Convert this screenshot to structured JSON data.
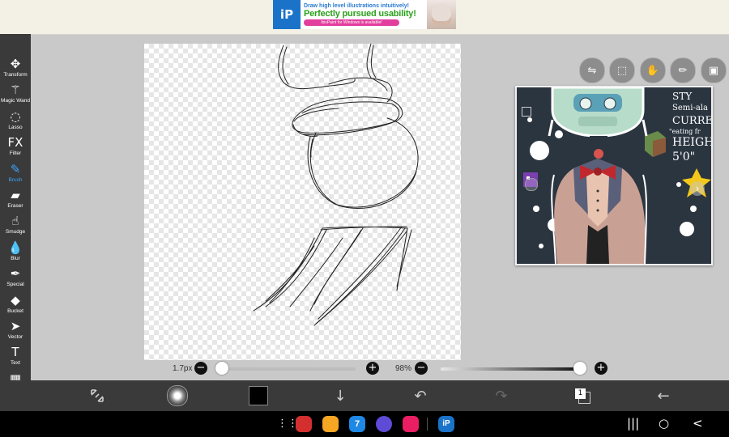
{
  "ad": {
    "logo": "iP",
    "line1": "Draw high level illustrations intuitively!",
    "line2": "Perfectly pursued usability!",
    "line3": "ibisPaint for Windows is available!"
  },
  "tools": [
    {
      "id": "transform",
      "icon": "move-icon",
      "glyph": "✥",
      "label": "Transform",
      "active": false
    },
    {
      "id": "magic-wand",
      "icon": "magic-wand-icon",
      "glyph": "⚚",
      "label": "Magic Wand",
      "active": false
    },
    {
      "id": "lasso",
      "icon": "lasso-icon",
      "glyph": "◌",
      "label": "Lasso",
      "active": false
    },
    {
      "id": "filter",
      "icon": "fx-icon",
      "glyph": "FX",
      "label": "Filter",
      "active": false
    },
    {
      "id": "brush",
      "icon": "brush-icon",
      "glyph": "✎",
      "label": "Brush",
      "active": true
    },
    {
      "id": "eraser",
      "icon": "eraser-icon",
      "glyph": "▰",
      "label": "Eraser",
      "active": false
    },
    {
      "id": "smudge",
      "icon": "smudge-icon",
      "glyph": "☝",
      "label": "Smudge",
      "active": false
    },
    {
      "id": "blur",
      "icon": "droplet-icon",
      "glyph": "💧",
      "label": "Blur",
      "active": false
    },
    {
      "id": "special",
      "icon": "special-pen-icon",
      "glyph": "✒",
      "label": "Special",
      "active": false
    },
    {
      "id": "bucket",
      "icon": "bucket-icon",
      "glyph": "◆",
      "label": "Bucket",
      "active": false
    },
    {
      "id": "vector",
      "icon": "cursor-arrow-icon",
      "glyph": "➤",
      "label": "Vector",
      "active": false
    },
    {
      "id": "text",
      "icon": "text-icon",
      "glyph": "T",
      "label": "Text",
      "active": false
    },
    {
      "id": "frame-divider",
      "icon": "frame-divider-icon",
      "glyph": "▦",
      "label": "Frame Divider",
      "active": false
    },
    {
      "id": "eyedropper",
      "icon": "eyedropper-icon",
      "glyph": "✐",
      "label": "",
      "active": false
    }
  ],
  "canvas_tools": [
    {
      "name": "toggle-icon",
      "glyph": "⇋"
    },
    {
      "name": "selection-icon",
      "glyph": "⬚"
    },
    {
      "name": "hand-icon",
      "glyph": "✋"
    },
    {
      "name": "ruler-icon",
      "glyph": "✏"
    },
    {
      "name": "reference-image-icon",
      "glyph": "▣"
    }
  ],
  "reference": {
    "texts": [
      "STY",
      "Semi-ala",
      "CURREN",
      "\"eating fr",
      "HEIGH",
      "5'0\""
    ]
  },
  "brush_size": {
    "value_label": "1.7px",
    "fraction": 0.0
  },
  "opacity": {
    "value_label": "98%",
    "fraction": 0.98
  },
  "bottom_bar": [
    {
      "name": "transform-layer-icon",
      "glyph": "⤢"
    },
    {
      "name": "brush-preview-icon",
      "glyph": ""
    },
    {
      "name": "color-swatch",
      "glyph": ""
    },
    {
      "name": "download-icon",
      "glyph": "↓"
    },
    {
      "name": "undo-icon",
      "glyph": "↶"
    },
    {
      "name": "redo-icon",
      "glyph": "↷"
    },
    {
      "name": "layers-icon",
      "glyph": "1"
    },
    {
      "name": "back-arrow-icon",
      "glyph": "←"
    }
  ],
  "colors": {
    "current": "#000000",
    "accent": "#3fa3ff"
  },
  "nav": {
    "recents": "|||",
    "home": "○",
    "back": "<",
    "badge": "7"
  }
}
